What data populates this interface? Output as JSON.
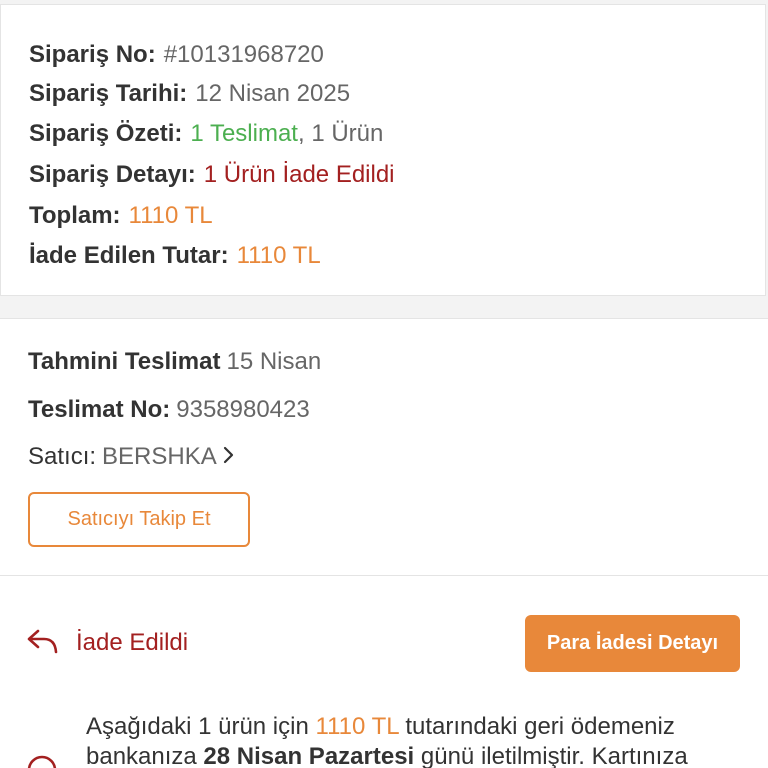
{
  "order_summary": {
    "order_no_label": "Sipariş No:",
    "order_no_value": "#10131968720",
    "order_date_label": "Sipariş Tarihi:",
    "order_date_value": "12 Nisan 2025",
    "summary_label": "Sipariş Özeti:",
    "summary_delivery": "1 Teslimat",
    "summary_sep": ",",
    "summary_items": " 1 Ürün",
    "detail_label": "Sipariş Detayı:",
    "detail_value": "1 Ürün İade Edildi",
    "total_label": "Toplam:",
    "total_value": "1110 TL",
    "refunded_label": "İade Edilen Tutar:",
    "refunded_value": "1110 TL"
  },
  "delivery": {
    "estimated_label": "Tahmini Teslimat",
    "estimated_value": "15 Nisan",
    "delivery_no_label": "Teslimat No:",
    "delivery_no_value": "9358980423",
    "seller_label": "Satıcı:",
    "seller_value": "BERSHKA",
    "follow_seller_button": "Satıcıyı Takip Et"
  },
  "refund": {
    "status_text": "İade Edildi",
    "refund_detail_button": "Para İadesi Detayı",
    "message_part1": "Aşağıdaki ",
    "message_count": "1",
    "message_part2": " ürün için ",
    "message_amount": "1110 TL",
    "message_part3": " tutarındaki geri ödemeniz bankanıza ",
    "message_date": "28 Nisan Pazartesi",
    "message_part4": " günü iletilmiştir. Kartınıza"
  },
  "colors": {
    "accent_orange": "#e8883a",
    "status_red": "#a32020",
    "success_green": "#4caf50"
  },
  "icons": {
    "chevron": "chevron-right-icon",
    "return": "return-arrow-icon",
    "info": "info-circle-icon"
  }
}
